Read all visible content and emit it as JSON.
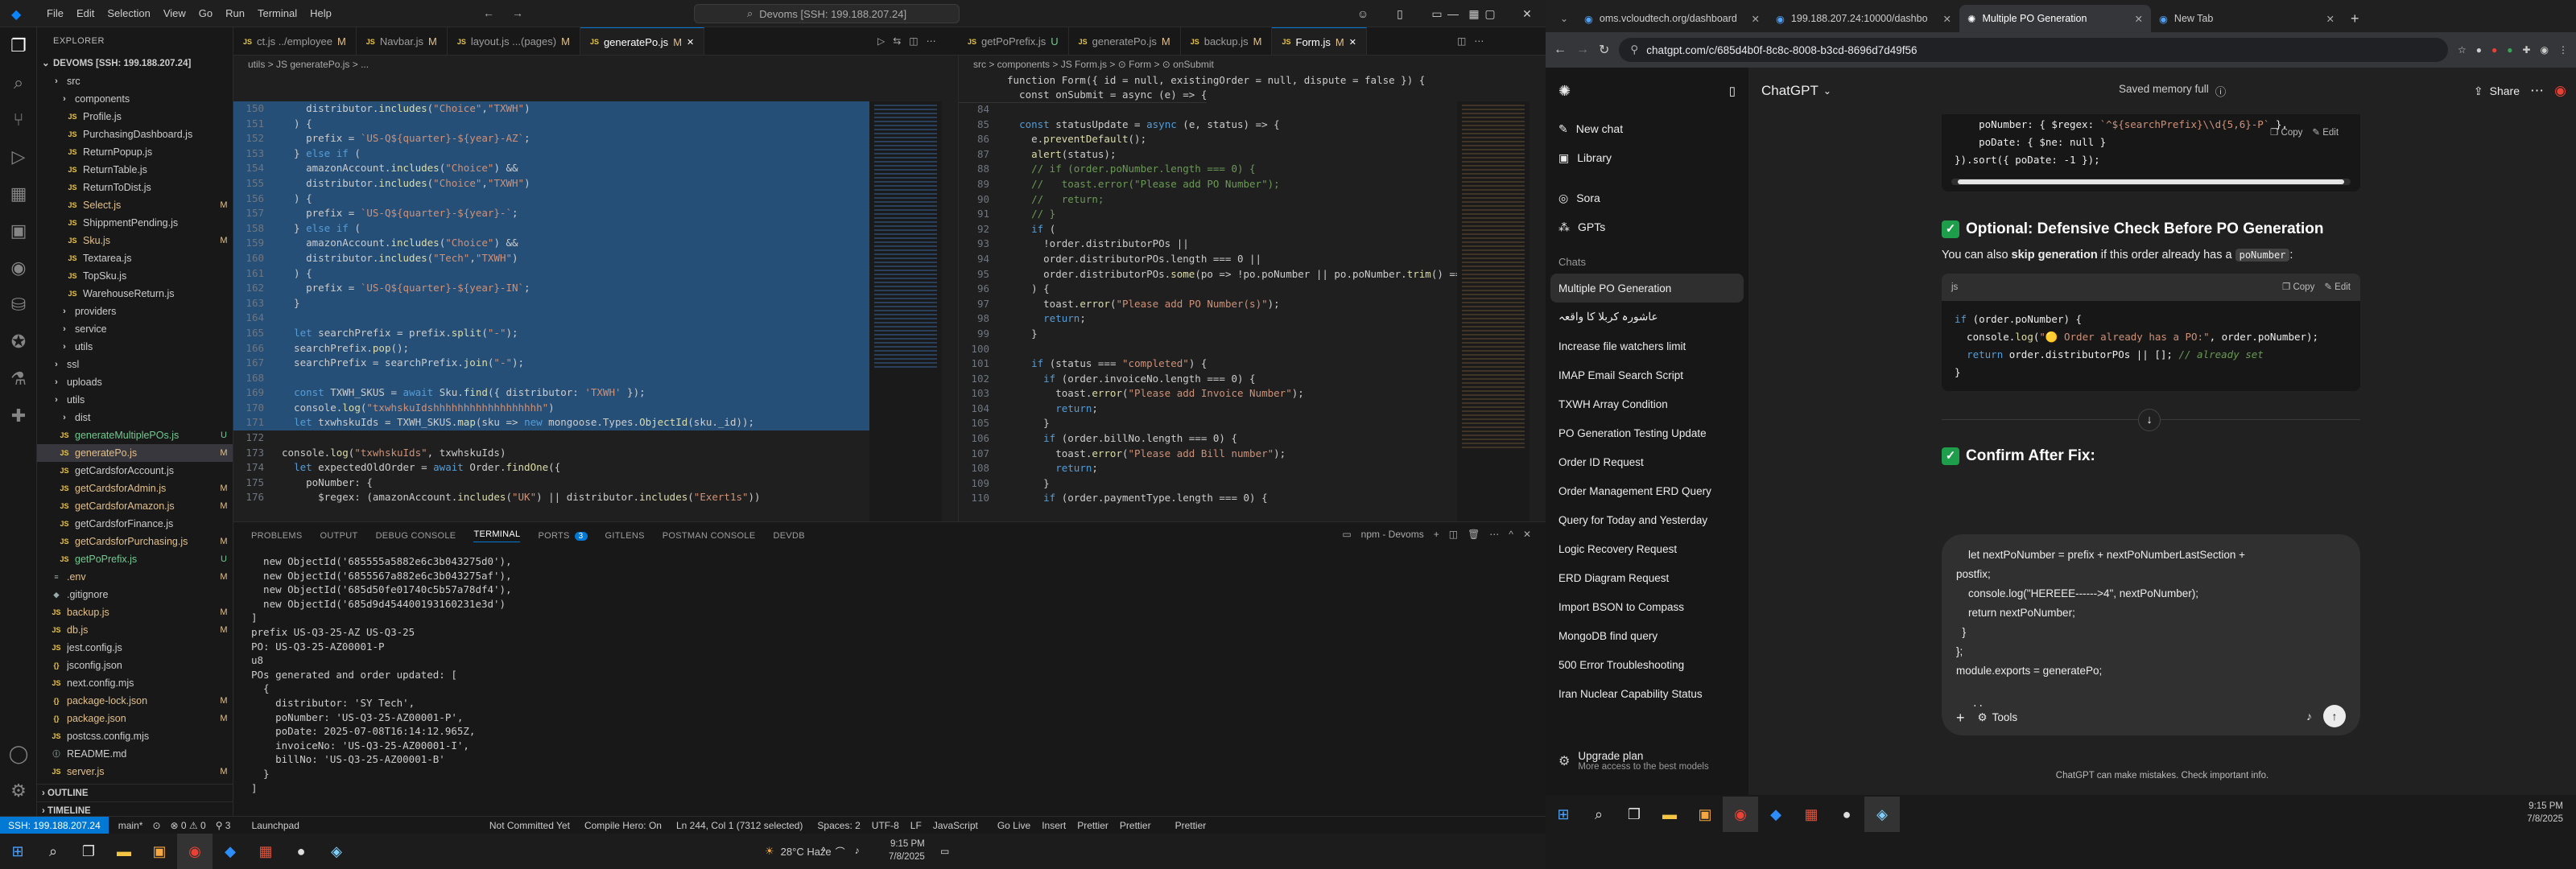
{
  "vscode": {
    "menu": [
      "File",
      "Edit",
      "Selection",
      "View",
      "Go",
      "Run",
      "Terminal",
      "Help"
    ],
    "command_center": "Devoms [SSH: 199.188.207.24]",
    "explorer": {
      "title": "EXPLORER",
      "root": "DEVOMS [SSH: 199.188.207.24]",
      "files": [
        {
          "name": "src",
          "type": "folder",
          "indent": 1
        },
        {
          "name": "components",
          "type": "folder",
          "indent": 2
        },
        {
          "name": "Profile.js",
          "indent": 3,
          "icon": "JS"
        },
        {
          "name": "PurchasingDashboard.js",
          "indent": 3,
          "icon": "JS"
        },
        {
          "name": "ReturnPopup.js",
          "indent": 3,
          "icon": "JS"
        },
        {
          "name": "ReturnTable.js",
          "indent": 3,
          "icon": "JS"
        },
        {
          "name": "ReturnToDist.js",
          "indent": 3,
          "icon": "JS"
        },
        {
          "name": "Select.js",
          "indent": 3,
          "icon": "JS",
          "mark": "M"
        },
        {
          "name": "ShippmentPending.js",
          "indent": 3,
          "icon": "JS"
        },
        {
          "name": "Sku.js",
          "indent": 3,
          "icon": "JS",
          "mark": "M"
        },
        {
          "name": "Textarea.js",
          "indent": 3,
          "icon": "JS"
        },
        {
          "name": "TopSku.js",
          "indent": 3,
          "icon": "JS"
        },
        {
          "name": "WarehouseReturn.js",
          "indent": 3,
          "icon": "JS"
        },
        {
          "name": "providers",
          "type": "folder",
          "indent": 2
        },
        {
          "name": "service",
          "type": "folder",
          "indent": 2
        },
        {
          "name": "utils",
          "type": "folder",
          "indent": 2
        },
        {
          "name": "ssl",
          "type": "folder",
          "indent": 1
        },
        {
          "name": "uploads",
          "type": "folder",
          "indent": 1
        },
        {
          "name": "utils",
          "type": "folder",
          "indent": 1
        },
        {
          "name": "dist",
          "type": "folder",
          "indent": 2
        },
        {
          "name": "generateMultiplePOs.js",
          "indent": 2,
          "icon": "JS",
          "mark": "U"
        },
        {
          "name": "generatePo.js",
          "indent": 2,
          "icon": "JS",
          "mark": "M",
          "sel": true
        },
        {
          "name": "getCardsforAccount.js",
          "indent": 2,
          "icon": "JS"
        },
        {
          "name": "getCardsforAdmin.js",
          "indent": 2,
          "icon": "JS",
          "mark": "M"
        },
        {
          "name": "getCardsforAmazon.js",
          "indent": 2,
          "icon": "JS",
          "mark": "M"
        },
        {
          "name": "getCardsforFinance.js",
          "indent": 2,
          "icon": "JS"
        },
        {
          "name": "getCardsforPurchasing.js",
          "indent": 2,
          "icon": "JS",
          "mark": "M"
        },
        {
          "name": "getPoPrefix.js",
          "indent": 2,
          "icon": "JS",
          "mark": "U"
        },
        {
          "name": ".env",
          "indent": 1,
          "icon": "≡",
          "mark": "M"
        },
        {
          "name": ".gitignore",
          "indent": 1,
          "icon": "◆"
        },
        {
          "name": "backup.js",
          "indent": 1,
          "icon": "JS",
          "mark": "M"
        },
        {
          "name": "db.js",
          "indent": 1,
          "icon": "JS",
          "mark": "M"
        },
        {
          "name": "jest.config.js",
          "indent": 1,
          "icon": "JS"
        },
        {
          "name": "jsconfig.json",
          "indent": 1,
          "icon": "{}"
        },
        {
          "name": "next.config.mjs",
          "indent": 1,
          "icon": "JS"
        },
        {
          "name": "package-lock.json",
          "indent": 1,
          "icon": "{}",
          "mark": "M"
        },
        {
          "name": "package.json",
          "indent": 1,
          "icon": "{}",
          "mark": "M"
        },
        {
          "name": "postcss.config.mjs",
          "indent": 1,
          "icon": "JS"
        },
        {
          "name": "README.md",
          "indent": 1,
          "icon": "ⓘ"
        },
        {
          "name": "server.js",
          "indent": 1,
          "icon": "JS",
          "mark": "M"
        }
      ],
      "outline": "OUTLINE",
      "timeline": "TIMELINE"
    },
    "tabs_left": [
      {
        "label": "ct.js ../employee",
        "mark": "M"
      },
      {
        "label": "Navbar.js",
        "mark": "M"
      },
      {
        "label": "layout.js ...(pages)",
        "mark": "M"
      },
      {
        "label": "generatePo.js",
        "mark": "M",
        "active": true
      }
    ],
    "tabs_right": [
      {
        "label": "getPoPrefix.js",
        "mark": "U"
      },
      {
        "label": "generatePo.js",
        "mark": "M"
      },
      {
        "label": "backup.js",
        "mark": "M"
      },
      {
        "label": "Form.js",
        "mark": "M",
        "active": true
      }
    ],
    "crumb_left": "utils > JS generatePo.js > ...",
    "crumb_right": "src > components > JS Form.js > ⊙ Form > ⊙ onSubmit",
    "left_code": [
      {
        "n": "150",
        "t": "    distributor.includes(\"Choice\",\"TXWH\")"
      },
      {
        "n": "151",
        "t": "  ) {"
      },
      {
        "n": "152",
        "t": "    prefix = `US-Q${quarter}-${year}-AZ`;"
      },
      {
        "n": "153",
        "t": "  } else if ("
      },
      {
        "n": "154",
        "t": "    amazonAccount.includes(\"Choice\") &&"
      },
      {
        "n": "155",
        "t": "    distributor.includes(\"Choice\",\"TXWH\")"
      },
      {
        "n": "156",
        "t": "  ) {"
      },
      {
        "n": "157",
        "t": "    prefix = `US-Q${quarter}-${year}-`;"
      },
      {
        "n": "158",
        "t": "  } else if ("
      },
      {
        "n": "159",
        "t": "    amazonAccount.includes(\"Choice\") &&"
      },
      {
        "n": "160",
        "t": "    distributor.includes(\"Tech\",\"TXWH\")"
      },
      {
        "n": "161",
        "t": "  ) {"
      },
      {
        "n": "162",
        "t": "    prefix = `US-Q${quarter}-${year}-IN`;"
      },
      {
        "n": "163",
        "t": "  }"
      },
      {
        "n": "164",
        "t": ""
      },
      {
        "n": "165",
        "t": "  let searchPrefix = prefix.split(\"-\");"
      },
      {
        "n": "166",
        "t": "  searchPrefix.pop();"
      },
      {
        "n": "167",
        "t": "  searchPrefix = searchPrefix.join(\"-\");"
      },
      {
        "n": "168",
        "t": ""
      },
      {
        "n": "169",
        "t": "  const TXWH_SKUS = await Sku.find({ distributor: 'TXWH' });"
      },
      {
        "n": "170",
        "t": "  console.log(\"txwhskuIdshhhhhhhhhhhhhhhhhh\")"
      },
      {
        "n": "171",
        "t": "  let txwhskuIds = TXWH_SKUS.map(sku => new mongoose.Types.ObjectId(sku._id));"
      },
      {
        "n": "172",
        "t": ""
      },
      {
        "n": "173",
        "t": "console.log(\"txwhskuIds\", txwhskuIds)"
      },
      {
        "n": "174",
        "t": "  let expectedOldOrder = await Order.findOne({"
      },
      {
        "n": "175",
        "t": "    poNumber: {"
      },
      {
        "n": "176",
        "t": "      $regex: (amazonAccount.includes(\"UK\") || distributor.includes(\"Exert1s\"))"
      }
    ],
    "right_code": [
      {
        "n": "84",
        "t": ""
      },
      {
        "n": "85",
        "t": "  const statusUpdate = async (e, status) => {"
      },
      {
        "n": "86",
        "t": "    e.preventDefault();"
      },
      {
        "n": "87",
        "t": "    alert(status);"
      },
      {
        "n": "88",
        "t": "    // if (order.poNumber.length === 0) {"
      },
      {
        "n": "89",
        "t": "    //   toast.error(\"Please add PO Number\");"
      },
      {
        "n": "90",
        "t": "    //   return;"
      },
      {
        "n": "91",
        "t": "    // }"
      },
      {
        "n": "92",
        "t": "    if ("
      },
      {
        "n": "93",
        "t": "      !order.distributorPOs ||"
      },
      {
        "n": "94",
        "t": "      order.distributorPOs.length === 0 ||"
      },
      {
        "n": "95",
        "t": "      order.distributorPOs.some(po => !po.poNumber || po.poNumber.trim() === \"\")"
      },
      {
        "n": "96",
        "t": "    ) {"
      },
      {
        "n": "97",
        "t": "      toast.error(\"Please add PO Number(s)\");"
      },
      {
        "n": "98",
        "t": "      return;"
      },
      {
        "n": "99",
        "t": "    }"
      },
      {
        "n": "100",
        "t": ""
      },
      {
        "n": "101",
        "t": "    if (status === \"completed\") {"
      },
      {
        "n": "102",
        "t": "      if (order.invoiceNo.length === 0) {"
      },
      {
        "n": "103",
        "t": "        toast.error(\"Please add Invoice Number\");"
      },
      {
        "n": "104",
        "t": "        return;"
      },
      {
        "n": "105",
        "t": "      }"
      },
      {
        "n": "106",
        "t": "      if (order.billNo.length === 0) {"
      },
      {
        "n": "107",
        "t": "        toast.error(\"Please add Bill number\");"
      },
      {
        "n": "108",
        "t": "        return;"
      },
      {
        "n": "109",
        "t": "      }"
      },
      {
        "n": "110",
        "t": "      if (order.paymentType.length === 0) {"
      }
    ],
    "right_sticky": "function Form({ id = null, existingOrder = null, dispute = false }) {",
    "right_sticky2": "  const onSubmit = async (e) => {",
    "panel_tabs": [
      "PROBLEMS",
      "OUTPUT",
      "DEBUG CONSOLE",
      "TERMINAL",
      "PORTS",
      "GITLENS",
      "POSTMAN CONSOLE",
      "DEVDB"
    ],
    "ports_badge": "3",
    "terminal_name": "npm - Devoms",
    "terminal": [
      "  new ObjectId('685555a5882e6c3b043275d0'),",
      "  new ObjectId('6855567a882e6c3b043275af'),",
      "  new ObjectId('685d50fe01740c5b57a78df4'),",
      "  new ObjectId('685d9d454400193160231e3d')",
      "]",
      "prefix US-Q3-25-AZ US-Q3-25",
      "PO: US-Q3-25-AZ00001-P",
      "u8",
      "POs generated and order updated: [",
      "  {",
      "    distributor: 'SY Tech',",
      "    poNumber: 'US-Q3-25-AZ00001-P',",
      "    poDate: 2025-07-08T16:14:12.965Z,",
      "    invoiceNo: 'US-Q3-25-AZ00001-I',",
      "    billNo: 'US-Q3-25-AZ00001-B'",
      "  }",
      "]"
    ],
    "status": {
      "remote": "SSH: 199.188.207.24",
      "branch": "main*",
      "sync": "⊙",
      "errors": "⊗ 0 ⚠ 0",
      "ports": "⚲ 3",
      "launchpad": "Launchpad",
      "commit": "Not Committed Yet",
      "compile": "Compile Hero: On",
      "pos": "Ln 244, Col 1 (7312 selected)",
      "spaces": "Spaces: 2",
      "enc": "UTF-8",
      "eol": "LF",
      "lang": "JavaScript",
      "golive": "Go Live",
      "insert": "Insert",
      "prettier": "Prettier",
      "prettier2": "Prettier",
      "prettier3": "Prettier"
    },
    "taskbar": {
      "weather": "28°C Haze",
      "time": "9:15 PM",
      "date": "7/8/2025"
    }
  },
  "chrome": {
    "tabs": [
      {
        "label": "oms.vcloudtech.org/dashboard"
      },
      {
        "label": "199.188.207.24:10000/dashbo"
      },
      {
        "label": "Multiple PO Generation",
        "active": true
      },
      {
        "label": "New Tab"
      }
    ],
    "url": "chatgpt.com/c/685d4b0f-8c8c-8008-b3cd-8696d7d49f56"
  },
  "chatgpt": {
    "sidebar": {
      "new_chat": "New chat",
      "library": "Library",
      "sora": "Sora",
      "gpts": "GPTs",
      "chats_label": "Chats",
      "chats": [
        "Multiple PO Generation",
        "عاشورہ کربلا کا واقعہ",
        "Increase file watchers limit",
        "IMAP Email Search Script",
        "TXWH Array Condition",
        "PO Generation Testing Update",
        "Order ID Request",
        "Order Management ERD Query",
        "Query for Today and Yesterday",
        "Logic Recovery Request",
        "ERD Diagram Request",
        "Import BSON to Compass",
        "MongoDB find query",
        "500 Error Troubleshooting",
        "Iran Nuclear Capability Status"
      ],
      "upgrade": "Upgrade plan",
      "upgrade_sub": "More access to the best models"
    },
    "header": {
      "model": "ChatGPT",
      "memory": "Saved memory full",
      "share": "Share"
    },
    "top_code": [
      "    poNumber: { $regex: `^${searchPrefix}\\\\d{5,6}-P` },",
      "    poDate: { $ne: null }",
      "}).sort({ poDate: -1 });"
    ],
    "section1_title": "Optional: Defensive Check Before PO Generation",
    "section1_text_a": "You can also ",
    "section1_text_b": "skip generation",
    "section1_text_c": " if this order already has a ",
    "section1_code_inline": "poNumber",
    "code_lang": "js",
    "copy": "Copy",
    "edit": "Edit",
    "code2": [
      "if (order.poNumber) {",
      "  console.log(\"🟡 Order already has a PO:\", order.poNumber);",
      "  return order.distributorPOs || []; // already set",
      "}"
    ],
    "section2_title": "Confirm After Fix:",
    "composer_lines": [
      "    let nextPoNumber = prefix + nextPoNumberLastSection +",
      "postfix;",
      "    console.log(\"HEREEE------>4\", nextPoNumber);",
      "    return nextPoNumber;",
      "  }",
      "};",
      "module.exports = generatePo;",
      "",
      "could"
    ],
    "tools": "Tools",
    "disclaimer": "ChatGPT can make mistakes. Check important info."
  },
  "right_taskbar": {
    "time": "9:15 PM",
    "date": "7/8/2025"
  }
}
